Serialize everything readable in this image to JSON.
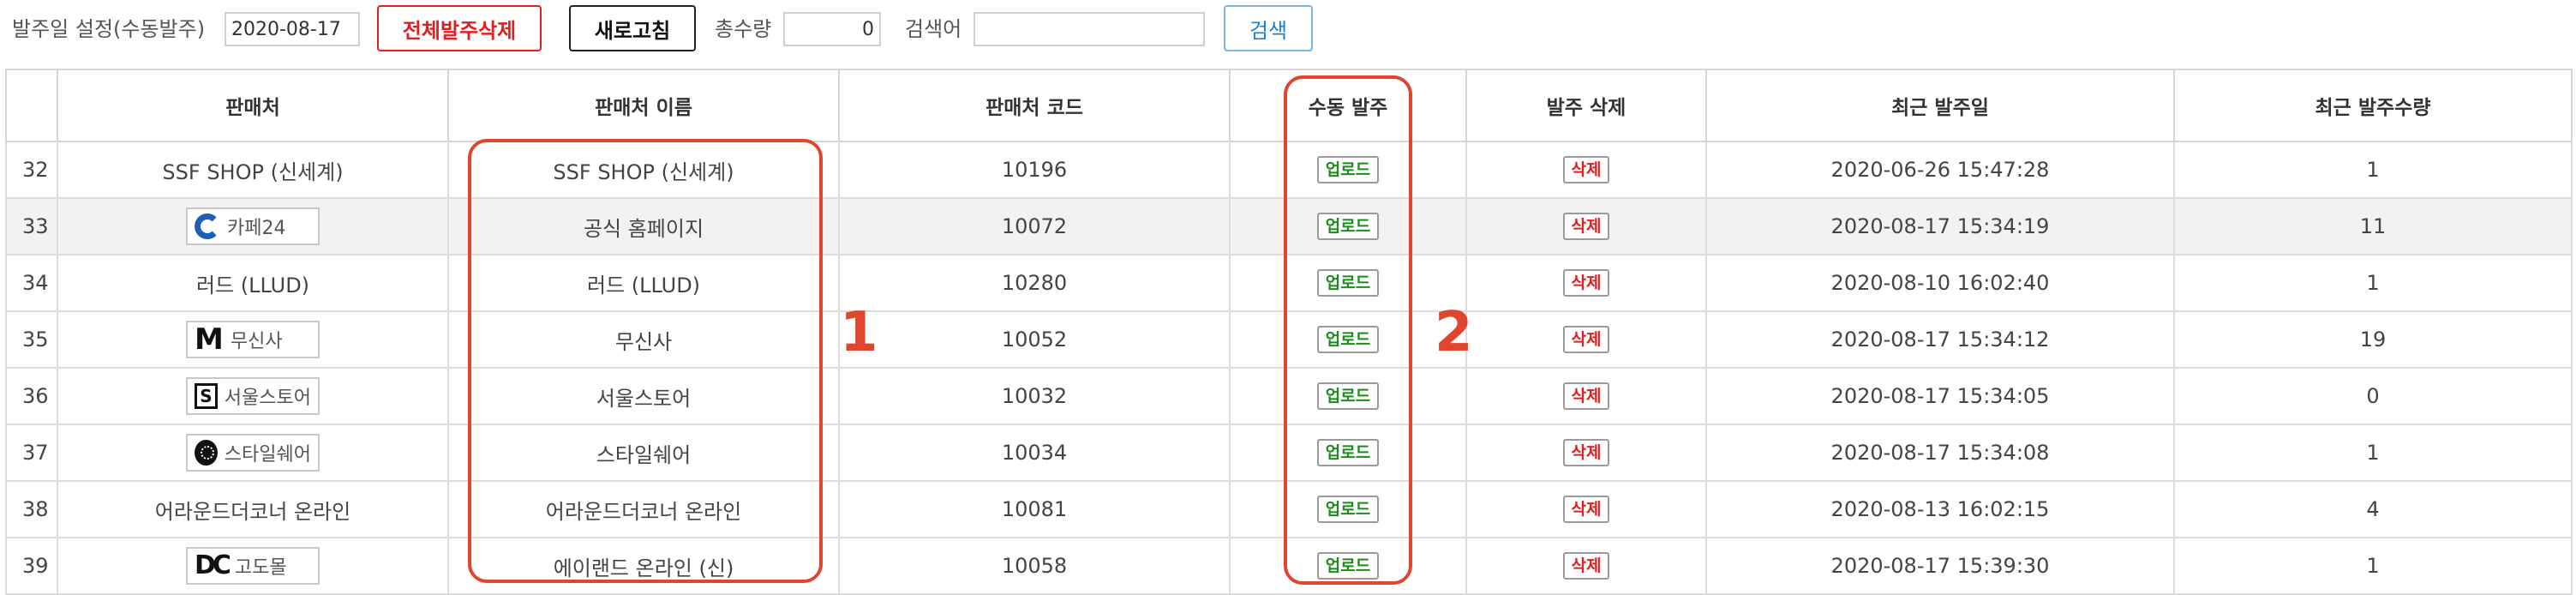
{
  "toolbar": {
    "date_label": "발주일 설정(수동발주)",
    "date_value": "2020-08-17",
    "delete_all_label": "전체발주삭제",
    "refresh_label": "새로고침",
    "total_qty_label": "총수량",
    "total_qty_value": "0",
    "search_label": "검색어",
    "search_value": "",
    "search_button_label": "검색"
  },
  "table": {
    "columns": [
      "판매처",
      "판매처 이름",
      "판매처 코드",
      "수동 발주",
      "발주 삭제",
      "최근 발주일",
      "최근 발주수량"
    ],
    "upload_label": "업로드",
    "delete_label": "삭제",
    "rows": [
      {
        "no": "32",
        "vendor": "SSF SHOP (신세계)",
        "logo": "",
        "logo_icon": "",
        "name": "SSF SHOP (신세계)",
        "code": "10196",
        "date": "2020-06-26 15:47:28",
        "recent": false,
        "qty": "1"
      },
      {
        "no": "33",
        "vendor": "",
        "logo": "카페24",
        "logo_icon": "cafe24-logo-icon",
        "name": "공식 홈페이지",
        "code": "10072",
        "date": "2020-08-17 15:34:19",
        "recent": true,
        "qty": "11"
      },
      {
        "no": "34",
        "vendor": "러드 (LLUD)",
        "logo": "",
        "logo_icon": "",
        "name": "러드 (LLUD)",
        "code": "10280",
        "date": "2020-08-10 16:02:40",
        "recent": false,
        "qty": "1"
      },
      {
        "no": "35",
        "vendor": "",
        "logo": "무신사",
        "logo_icon": "musinsa-logo-icon",
        "name": "무신사",
        "code": "10052",
        "date": "2020-08-17 15:34:12",
        "recent": true,
        "qty": "19"
      },
      {
        "no": "36",
        "vendor": "",
        "logo": "서울스토어",
        "logo_icon": "seoulstore-logo-icon",
        "name": "서울스토어",
        "code": "10032",
        "date": "2020-08-17 15:34:05",
        "recent": true,
        "qty": "0"
      },
      {
        "no": "37",
        "vendor": "",
        "logo": "스타일쉐어",
        "logo_icon": "styleshare-logo-icon",
        "name": "스타일쉐어",
        "code": "10034",
        "date": "2020-08-17 15:34:08",
        "recent": true,
        "qty": "1"
      },
      {
        "no": "38",
        "vendor": "어라운드더코너 온라인",
        "logo": "",
        "logo_icon": "",
        "name": "어라운드더코너 온라인",
        "code": "10081",
        "date": "2020-08-13 16:02:15",
        "recent": false,
        "qty": "4"
      },
      {
        "no": "39",
        "vendor": "",
        "logo": "고도몰",
        "logo_icon": "godomall-logo-icon",
        "name": "에이랜드 온라인 (신)",
        "code": "10058",
        "date": "2020-08-17 15:39:30",
        "recent": true,
        "qty": "1"
      }
    ]
  },
  "annotations": {
    "label_1": "1",
    "label_2": "2",
    "color": "#e0452e"
  },
  "colors": {
    "recent_date": "#0000e6",
    "old_date": "#666666",
    "delete_all": "#e02020",
    "search_button": "#1a7fd0",
    "upload": "#1d8c1d",
    "delete": "#e02020"
  }
}
